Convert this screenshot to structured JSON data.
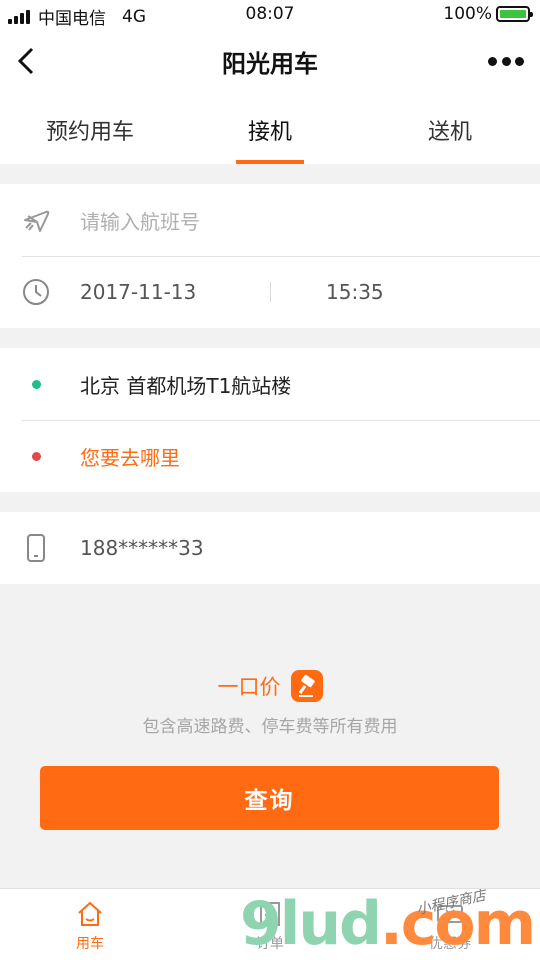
{
  "status_bar": {
    "carrier": "中国电信",
    "network": "4G",
    "time": "08:07",
    "battery": "100%"
  },
  "header": {
    "title": "阳光用车"
  },
  "tabs": [
    {
      "label": "预约用车",
      "active": false
    },
    {
      "label": "接机",
      "active": true
    },
    {
      "label": "送机",
      "active": false
    }
  ],
  "flight": {
    "placeholder": "请输入航班号"
  },
  "datetime": {
    "date": "2017-11-13",
    "time": "15:35"
  },
  "route": {
    "origin": "北京 首都机场T1航站楼",
    "destination_placeholder": "您要去哪里"
  },
  "contact": {
    "phone": "188******33"
  },
  "pricing": {
    "label": "一口价",
    "note": "包含高速路费、停车费等所有费用"
  },
  "actions": {
    "query_label": "查询"
  },
  "bottom_nav": [
    {
      "label": "用车",
      "active": true
    },
    {
      "label": "订单",
      "active": false
    },
    {
      "label": "优惠券",
      "active": false
    }
  ],
  "watermark": {
    "brand": "9lud",
    "suffix": ".com",
    "tagline": "小程序商店"
  },
  "colors": {
    "accent": "#ff6a13",
    "origin_dot": "#1dbf8a",
    "destination_dot": "#e04a4a"
  }
}
